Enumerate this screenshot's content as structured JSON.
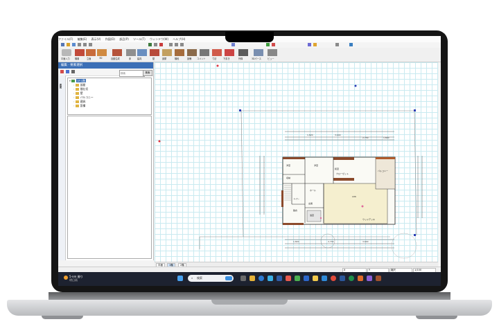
{
  "app": {
    "menu_items": [
      "ファイル(F)",
      "編集(E)",
      "表示(V)",
      "作図(D)",
      "部品(P)",
      "ツール(T)",
      "ウィンドウ(W)",
      "ヘルプ(H)"
    ],
    "toolbar_labels": [
      "平面入力",
      "階層",
      "立面",
      "3D",
      "自動生成",
      "床",
      "建具",
      "壁",
      "部屋",
      "階段",
      "設備",
      "コメント",
      "寸法",
      "下書き",
      "外構",
      "3Dパース",
      "ビュー"
    ]
  },
  "panel": {
    "title": "編集 · 要素選択",
    "search_placeholder": "検索",
    "search_button": "検索",
    "vtab": "要素",
    "tree": {
      "root": "1F:1階",
      "items": [
        "部屋",
        "間仕切",
        "壁",
        "バルコニー",
        "建具",
        "設備"
      ]
    }
  },
  "plan": {
    "rooms": [
      "洋室",
      "収納",
      "洋室",
      "和室",
      "LDK",
      "ホール",
      "玄関",
      "浴室",
      "トイレ",
      "脱衣",
      "クローゼット",
      "バルコニー",
      "ウッドデッキ"
    ],
    "dims_top": [
      "1,820",
      "3,640",
      "2,730",
      "1,820"
    ],
    "dims_bottom": [
      "1,820",
      "2,730",
      "3,640"
    ]
  },
  "sheets": [
    "平面",
    "1階",
    "2階"
  ],
  "status": {
    "fields": [
      "X",
      "Y",
      "縮尺",
      "1/100"
    ]
  },
  "taskbar": {
    "weather_temp": "5-nm 曇り",
    "weather_desc": "明日雨",
    "search_placeholder": "検索"
  }
}
